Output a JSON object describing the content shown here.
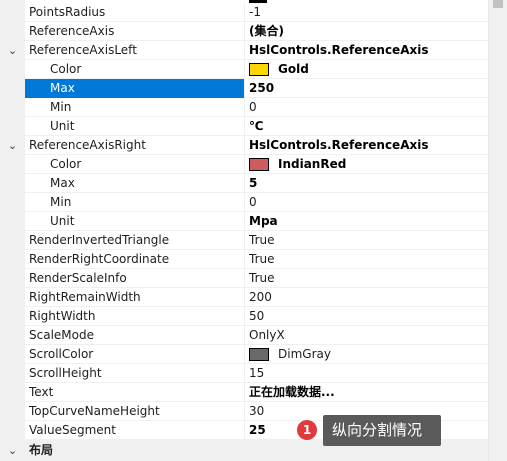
{
  "property_grid": {
    "rows": [
      {
        "name": "PointsRadius",
        "value": "-1",
        "bold": false
      },
      {
        "name": "ReferenceAxis",
        "value": "(集合)",
        "bold": true
      },
      {
        "name": "ReferenceAxisLeft",
        "value": "HslControls.ReferenceAxis",
        "bold": true,
        "expander": "⌄"
      },
      {
        "name": "Color",
        "value": "Gold",
        "bold": true,
        "child": true,
        "swatch": "#ffd700"
      },
      {
        "name": "Max",
        "value": "250",
        "bold": true,
        "child": true,
        "selected": true
      },
      {
        "name": "Min",
        "value": "0",
        "bold": false,
        "child": true
      },
      {
        "name": "Unit",
        "value": "℃",
        "bold": true,
        "child": true
      },
      {
        "name": "ReferenceAxisRight",
        "value": "HslControls.ReferenceAxis",
        "bold": true,
        "expander": "⌄"
      },
      {
        "name": "Color",
        "value": "IndianRed",
        "bold": true,
        "child": true,
        "swatch": "#cd5c5c"
      },
      {
        "name": "Max",
        "value": "5",
        "bold": true,
        "child": true
      },
      {
        "name": "Min",
        "value": "0",
        "bold": false,
        "child": true
      },
      {
        "name": "Unit",
        "value": "Mpa",
        "bold": true,
        "child": true
      },
      {
        "name": "RenderInvertedTriangle",
        "value": "True",
        "bold": false
      },
      {
        "name": "RenderRightCoordinate",
        "value": "True",
        "bold": false
      },
      {
        "name": "RenderScaleInfo",
        "value": "True",
        "bold": false
      },
      {
        "name": "RightRemainWidth",
        "value": "200",
        "bold": false
      },
      {
        "name": "RightWidth",
        "value": "50",
        "bold": false
      },
      {
        "name": "ScaleMode",
        "value": "OnlyX",
        "bold": false
      },
      {
        "name": "ScrollColor",
        "value": "DimGray",
        "bold": false,
        "swatch": "#696969"
      },
      {
        "name": "ScrollHeight",
        "value": "15",
        "bold": false
      },
      {
        "name": "Text",
        "value": "正在加载数据...",
        "bold": true
      },
      {
        "name": "TopCurveNameHeight",
        "value": "30",
        "bold": false
      },
      {
        "name": "ValueSegment",
        "value": "25",
        "bold": true
      }
    ],
    "category": {
      "label": "布局",
      "expander": "⌄"
    }
  },
  "tooltip": {
    "badge": "1",
    "text": "纵向分割情况"
  },
  "colors": {
    "selection": "#0078d7",
    "gutter": "#f0f0f0",
    "badge": "#e0393e",
    "tooltip_bg": "#5a5a5a"
  }
}
